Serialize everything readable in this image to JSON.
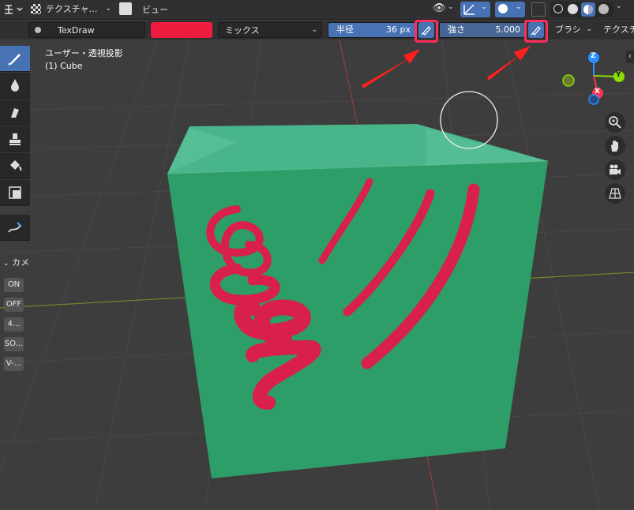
{
  "header": {
    "mode_label": "テクスチャ…",
    "view_menu": "ビュー"
  },
  "tool_settings": {
    "brush_name": "TexDraw",
    "brush_color": "#ee1c3e",
    "blend_mode": "ミックス",
    "radius_label": "半径",
    "radius_value": "36 px",
    "strength_label": "強さ",
    "strength_value": "5.000",
    "brush_menu": "ブラシ",
    "texture_menu": "テクスチ"
  },
  "viewport": {
    "view_name": "ユーザー・透視投影",
    "object_name": "(1) Cube"
  },
  "sidebar": {
    "panel_title": "カメ",
    "buttons": [
      "ON",
      "OFF",
      "4...",
      "SO...",
      "V-..."
    ]
  },
  "gizmo": {
    "z_label": "Z",
    "y_label": "Y",
    "x_label": "X"
  },
  "colors": {
    "accent": "#4772b3",
    "highlight": "#ff2d5e",
    "cube": "#2e9e68",
    "paint": "#d8204a",
    "axis_x": "#ff3352",
    "axis_y": "#8bdc00",
    "axis_z": "#2890ff"
  }
}
